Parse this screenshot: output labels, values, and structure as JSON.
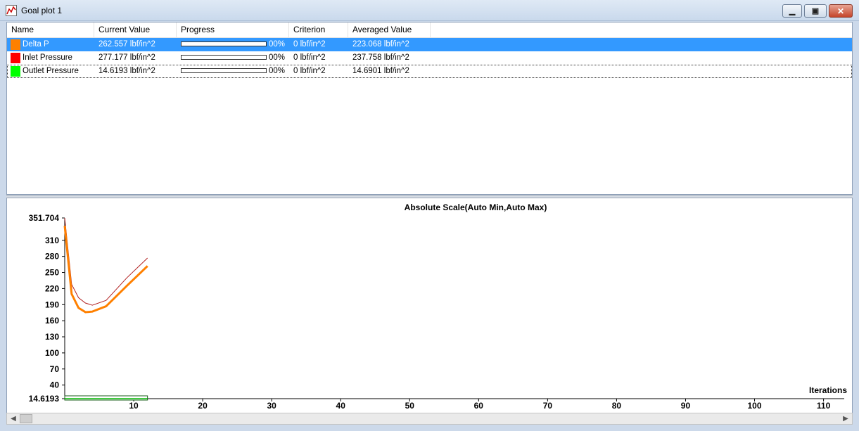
{
  "window": {
    "title": "Goal plot 1"
  },
  "table": {
    "headers": [
      "Name",
      "Current Value",
      "Progress",
      "Criterion",
      "Averaged Value"
    ],
    "rows": [
      {
        "name": "Delta P",
        "color": "#ff8000",
        "current": "262.557 lbf/in^2",
        "progress_pct": 100,
        "progress_label": "00%",
        "criterion": "0 lbf/in^2",
        "averaged": "223.068 lbf/in^2"
      },
      {
        "name": "Inlet Pressure",
        "color": "#ff0000",
        "current": "277.177 lbf/in^2",
        "progress_pct": 100,
        "progress_label": "00%",
        "criterion": "0 lbf/in^2",
        "averaged": "237.758 lbf/in^2"
      },
      {
        "name": "Outlet Pressure",
        "color": "#00ff00",
        "current": "14.6193 lbf/in^2",
        "progress_pct": 100,
        "progress_label": "00%",
        "criterion": "0 lbf/in^2",
        "averaged": "14.6901 lbf/in^2"
      }
    ]
  },
  "chart_data": {
    "type": "line",
    "title": "Absolute Scale(Auto Min,Auto Max)",
    "xlabel": "Iterations",
    "ylabel": "",
    "xlim": [
      0,
      113
    ],
    "ylim": [
      14.6193,
      351.704
    ],
    "x_ticks": [
      10,
      20,
      30,
      40,
      50,
      60,
      70,
      80,
      90,
      100,
      110
    ],
    "y_ticks": [
      "351.704",
      "310",
      "280",
      "250",
      "220",
      "190",
      "160",
      "130",
      "100",
      "70",
      "40",
      "14.6193"
    ],
    "grid": false,
    "series": [
      {
        "name": "Inlet Pressure",
        "color": "#b22222",
        "x": [
          0,
          1,
          2,
          3,
          4,
          6,
          9,
          12
        ],
        "y": [
          351.7,
          228,
          203,
          193,
          189,
          198,
          240,
          277
        ]
      },
      {
        "name": "Delta P",
        "color": "#ff8000",
        "x": [
          0,
          1,
          2,
          3,
          4,
          6,
          9,
          12
        ],
        "y": [
          337,
          210,
          184,
          176,
          177,
          187,
          225,
          262
        ]
      },
      {
        "name": "Outlet Pressure",
        "color": "#00bb00",
        "x": [
          0,
          1,
          2,
          3,
          4,
          6,
          9,
          12
        ],
        "y": [
          14.62,
          14.62,
          14.62,
          14.62,
          14.62,
          14.62,
          14.62,
          14.62
        ]
      }
    ]
  }
}
